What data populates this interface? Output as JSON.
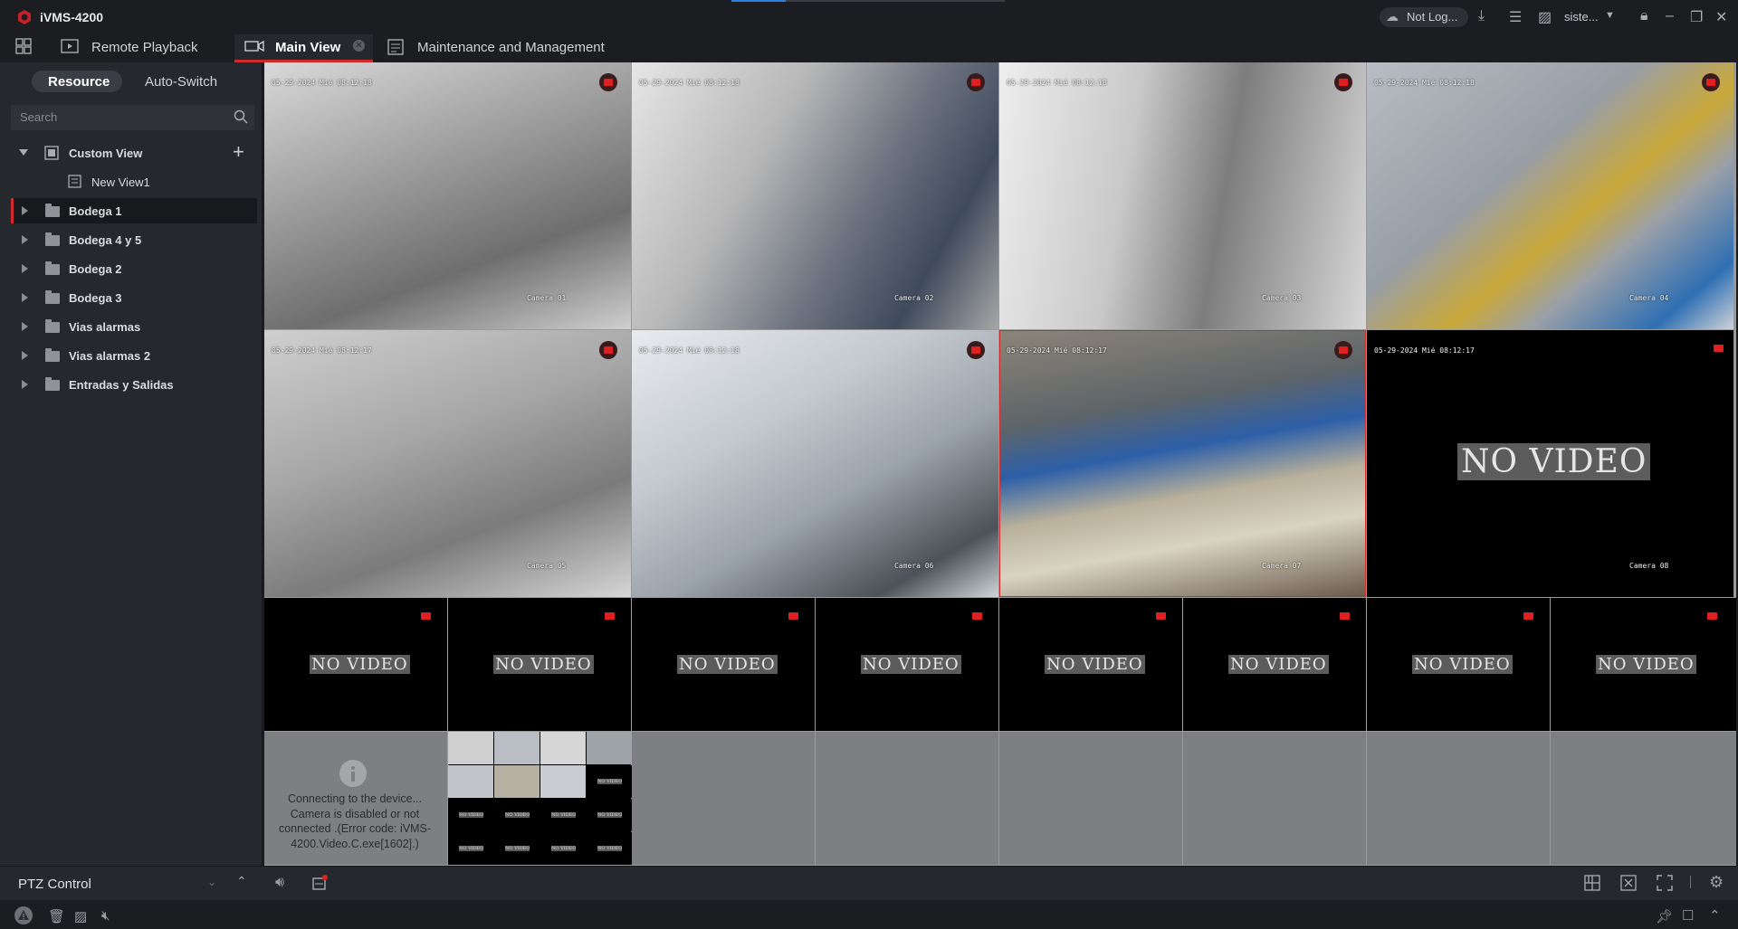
{
  "app": {
    "title": "iVMS-4200"
  },
  "titlebar": {
    "account_text": "Not Log...",
    "user_text": "siste..."
  },
  "tabs": [
    {
      "label": "Remote Playback"
    },
    {
      "label": "Main View"
    },
    {
      "label": "Maintenance and Management"
    }
  ],
  "sidebar": {
    "segments": [
      "Resource",
      "Auto-Switch"
    ],
    "search_placeholder": "Search",
    "custom_view": "Custom View",
    "custom_view_child": "New View1",
    "groups": [
      "Bodega 1",
      "Bodega 4 y 5",
      "Bodega 2",
      "Bodega 3",
      "Vias alarmas",
      "Vias alarmas 2",
      "Entradas y Salidas"
    ]
  },
  "ptz": {
    "label": "PTZ Control"
  },
  "cameras": {
    "large": [
      {
        "timestamp": "05-29-2024 Mié 08:12:18",
        "name": "Camera 01",
        "state": "video"
      },
      {
        "timestamp": "05-29-2024 Mié 08:12:18",
        "name": "Camera 02",
        "state": "video"
      },
      {
        "timestamp": "05-29-2024 Mié 08:12:18",
        "name": "Camera 03",
        "state": "video"
      },
      {
        "timestamp": "05-29-2024 Mié 08:12:18",
        "name": "Camera 04",
        "state": "video"
      },
      {
        "timestamp": "05-29-2024 Mié 08:12:17",
        "name": "Camera 05",
        "state": "video"
      },
      {
        "timestamp": "05-29-2024 Mié 08:12:18",
        "name": "Camera 06",
        "state": "video"
      },
      {
        "timestamp": "05-29-2024 Mié 08:12:17",
        "name": "Camera 07",
        "state": "video"
      },
      {
        "timestamp": "05-29-2024 Mié 08:12:17",
        "name": "Camera 08",
        "state": "novideo"
      }
    ],
    "no_video_text": "NO VIDEO",
    "error_message": "Connecting to the device... Camera is disabled or not connected .(Error code: iVMS-4200.Video.C.exe[1602].)",
    "thumb_no_video": "NO VIDEO"
  },
  "colors": {
    "accent": "#d22a2a",
    "record": "#e02020",
    "background": "#1b1d21"
  }
}
